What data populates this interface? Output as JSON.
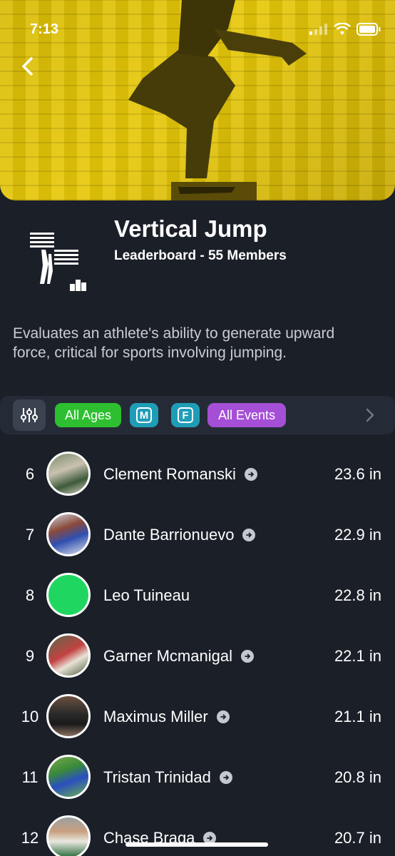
{
  "status": {
    "time": "7:13"
  },
  "leaderboard": {
    "title": "Vertical Jump",
    "subtitle": "Leaderboard - 55 Members",
    "description": "Evaluates an athlete's ability to generate upward force, critical for sports involving jumping."
  },
  "filters": {
    "ages": "All Ages",
    "male": "M",
    "female": "F",
    "events": "All Events"
  },
  "entries": [
    {
      "rank": "6",
      "name": "Clement Romanski",
      "score": "23.6 in",
      "avatar": "photo"
    },
    {
      "rank": "7",
      "name": "Dante Barrionuevo",
      "score": "22.9 in",
      "avatar": "photo"
    },
    {
      "rank": "8",
      "name": "Leo Tuineau",
      "score": "22.8 in",
      "avatar": "placeholder-green"
    },
    {
      "rank": "9",
      "name": "Garner Mcmanigal",
      "score": "22.1 in",
      "avatar": "photo"
    },
    {
      "rank": "10",
      "name": "Maximus Miller",
      "score": "21.1 in",
      "avatar": "photo"
    },
    {
      "rank": "11",
      "name": "Tristan Trinidad",
      "score": "20.8 in",
      "avatar": "photo"
    },
    {
      "rank": "12",
      "name": "Chase Braga",
      "score": "20.7 in",
      "avatar": "photo"
    }
  ],
  "colors": {
    "background": "#1b1f28",
    "hero": "#e0c208",
    "chip_ages": "#2ebf30",
    "chip_gender": "#1f9db7",
    "chip_events": "#a54fd6",
    "placeholder_avatar": "#1fd760"
  },
  "icons": [
    "back-chevron-icon",
    "signal-icon",
    "wifi-icon",
    "battery-icon",
    "filter-sliders-icon",
    "chevron-right-icon",
    "arrow-right-circle-icon"
  ]
}
